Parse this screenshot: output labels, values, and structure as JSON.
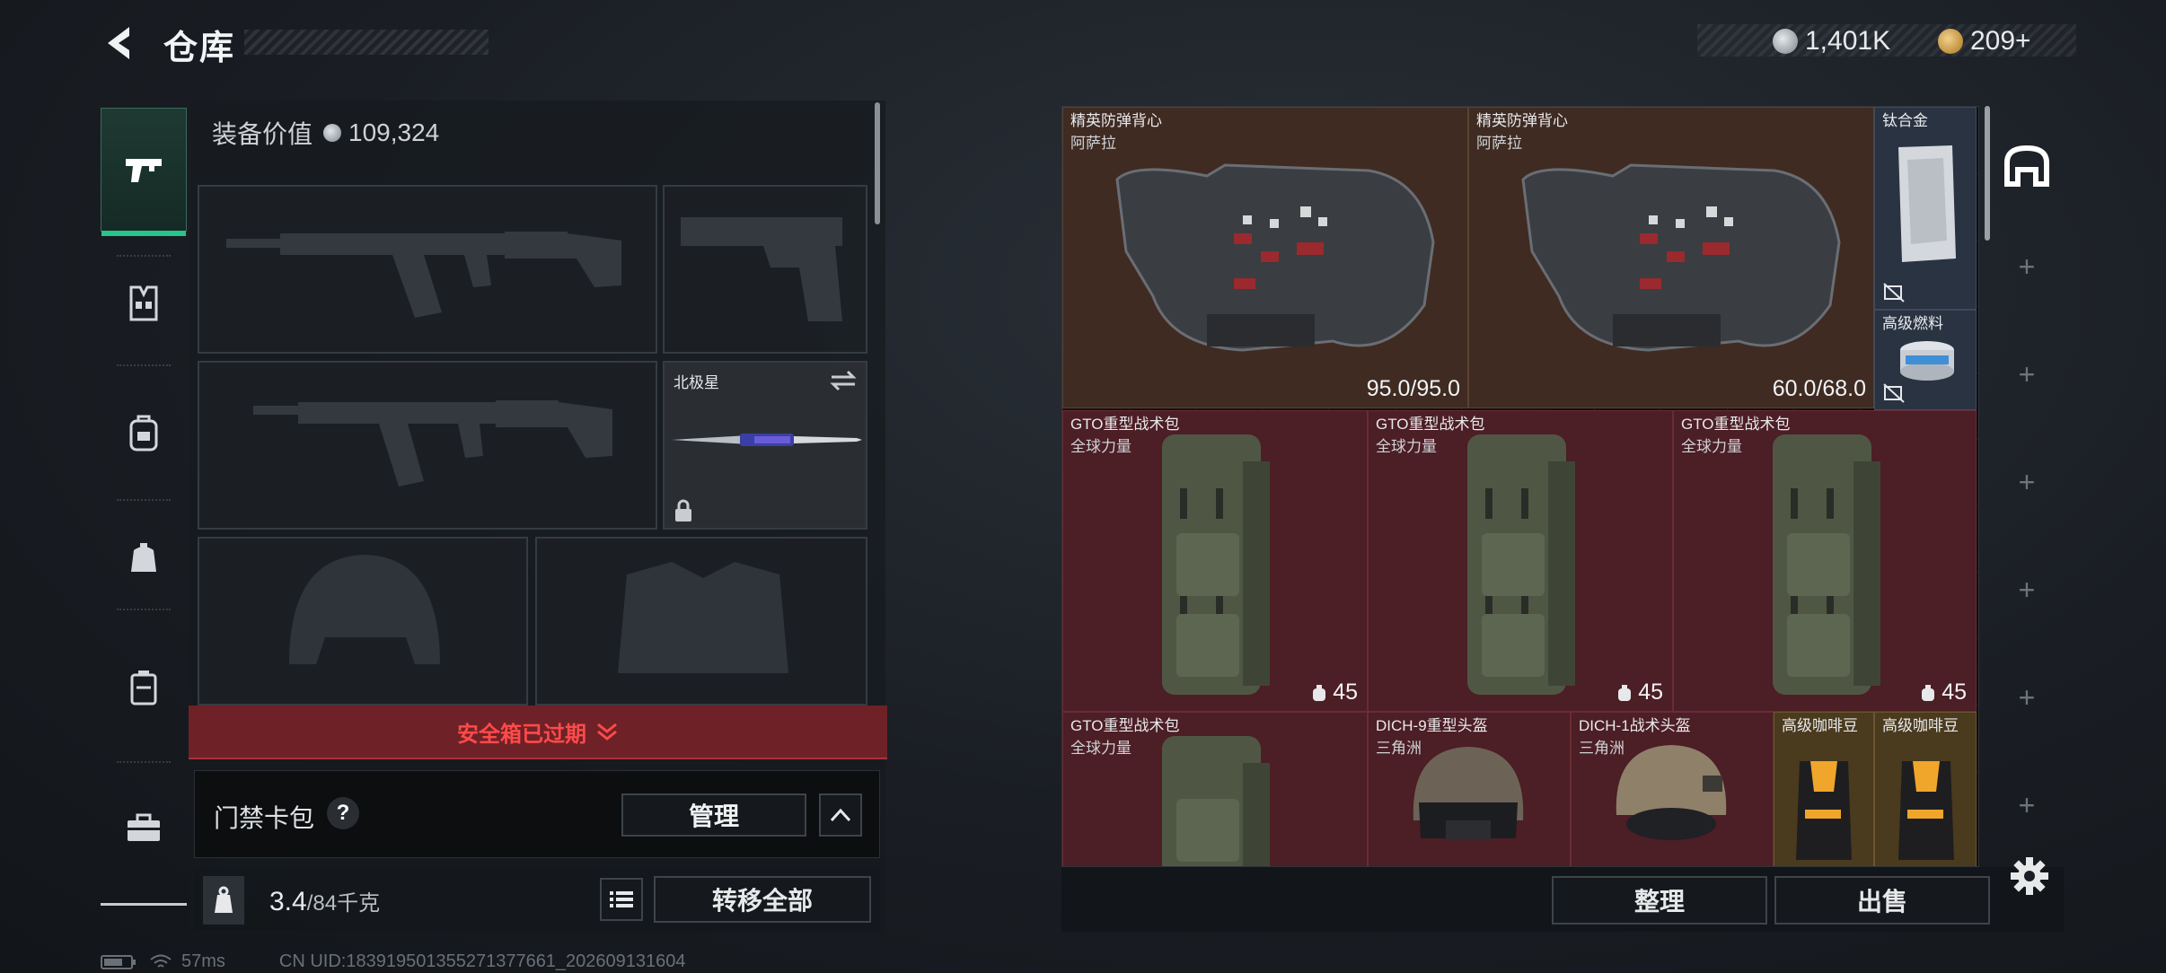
{
  "header": {
    "title": "仓库",
    "currency_silver": "1,401K",
    "currency_gold": "209+"
  },
  "nav": {
    "items": [
      {
        "name": "weapons",
        "icon": "pistol-icon",
        "active": true
      },
      {
        "name": "chest-rig",
        "icon": "chest-rig-icon"
      },
      {
        "name": "backpack-a",
        "icon": "backpack-icon"
      },
      {
        "name": "pouch",
        "icon": "pouch-icon"
      },
      {
        "name": "case",
        "icon": "case-icon"
      },
      {
        "name": "toolbox",
        "icon": "toolbox-icon"
      }
    ]
  },
  "loadout": {
    "equip_value_label": "装备价值",
    "equip_value": "109,324",
    "melee_name": "北极星",
    "expired_text": "安全箱已过期",
    "card_pack_label": "门禁卡包",
    "help_label": "?",
    "manage_label": "管理",
    "weight_current": "3.4",
    "weight_max": "/84千克",
    "transfer_all_label": "转移全部"
  },
  "storage": {
    "items": [
      {
        "name": "精英防弹背心",
        "sub": "阿萨拉",
        "value": "95.0/95.0",
        "kind": "vest"
      },
      {
        "name": "精英防弹背心",
        "sub": "阿萨拉",
        "value": "60.0/68.0",
        "kind": "vest"
      },
      {
        "name": "钛合金",
        "kind": "metal"
      },
      {
        "name": "高级燃料",
        "kind": "fuel"
      },
      {
        "name": "GTO重型战术包",
        "sub": "全球力量",
        "capacity": "45"
      },
      {
        "name": "GTO重型战术包",
        "sub": "全球力量",
        "capacity": "45"
      },
      {
        "name": "GTO重型战术包",
        "sub": "全球力量",
        "capacity": "45"
      },
      {
        "name": "GTO重型战术包",
        "sub": "全球力量"
      },
      {
        "name": "DICH-9重型头盔",
        "sub": "三角洲"
      },
      {
        "name": "DICH-1战术头盔",
        "sub": "三角洲"
      },
      {
        "name": "高级咖啡豆"
      },
      {
        "name": "高级咖啡豆"
      }
    ],
    "tidy_label": "整理",
    "sell_label": "出售"
  },
  "status": {
    "ping": "57ms",
    "uid": "CN UID:183919501355271377661_202609131604"
  },
  "colors": {
    "accent_green": "#27c58b",
    "alert_red": "#ff4a4a",
    "brown_rarity": "#3f2b22",
    "red_rarity": "#4c1e25"
  }
}
